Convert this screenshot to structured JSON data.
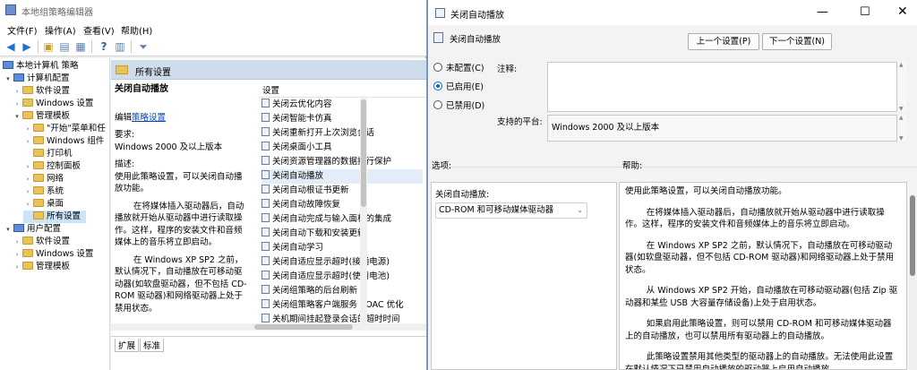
{
  "gpedit": {
    "title": "本地组策略编辑器",
    "menu": [
      "文件(F)",
      "操作(A)",
      "查看(V)",
      "帮助(H)"
    ],
    "tree": [
      {
        "label": "本地计算机 策略",
        "level": 0
      },
      {
        "label": "计算机配置",
        "level": 1
      },
      {
        "label": "软件设置",
        "level": 2
      },
      {
        "label": "Windows 设置",
        "level": 2
      },
      {
        "label": "管理模板",
        "level": 2
      },
      {
        "label": "\"开始\"菜单和任",
        "level": 3
      },
      {
        "label": "Windows 组件",
        "level": 3
      },
      {
        "label": "打印机",
        "level": 3
      },
      {
        "label": "控制面板",
        "level": 3
      },
      {
        "label": "网络",
        "level": 3
      },
      {
        "label": "系统",
        "level": 3
      },
      {
        "label": "桌面",
        "level": 3
      },
      {
        "label": "所有设置",
        "level": 3
      },
      {
        "label": "用户配置",
        "level": 1
      },
      {
        "label": "软件设置",
        "level": 2
      },
      {
        "label": "Windows 设置",
        "level": 2
      },
      {
        "label": "管理模板",
        "level": 2
      }
    ],
    "mid_header": "所有设置",
    "desc": {
      "title": "关闭自动播放",
      "edit_prefix": "编辑",
      "edit_link": "策略设置",
      "req_label": "要求:",
      "req_value": "Windows 2000 及以上版本",
      "desc_label": "描述:",
      "desc_p1": "使用此策略设置，可以关闭自动播放功能。",
      "desc_p2": "在将媒体插入驱动器后，自动播放就开始从驱动器中进行读取操作。这样，程序的安装文件和音频媒体上的音乐将立即启动。",
      "desc_p3": "在 Windows XP SP2 之前，默认情况下，自动播放在可移动驱动器(如软盘驱动器，但不包括 CD-ROM 驱动器)和网络驱动器上处于禁用状态。"
    },
    "list_header": "设置",
    "list_items": [
      "关闭云优化内容",
      "关闭智能卡仿真",
      "关闭重新打开上次浏览会话",
      "关闭桌面小工具",
      "关闭资源管理器的数据执行保护",
      "关闭自动播放",
      "关闭自动根证书更新",
      "关闭自动故障恢复",
      "关闭自动完成与输入面板的集成",
      "关闭自动下载和安装更新",
      "关闭自动学习",
      "关闭自适应显示超时(接通电源)",
      "关闭自适应显示超时(使用电池)",
      "关闭组策略的后台刷新",
      "关闭组策略客户端服务 AOAC 优化",
      "关机期间挂起登录会话的超时时间"
    ],
    "tabs": [
      "扩展",
      "标准"
    ]
  },
  "dialog": {
    "title": "关闭自动播放",
    "policy_name": "关闭自动播放",
    "prev_button": "上一个设置(P)",
    "next_button": "下一个设置(N)",
    "radios": [
      {
        "label": "未配置(C)",
        "checked": false
      },
      {
        "label": "已启用(E)",
        "checked": true
      },
      {
        "label": "已禁用(D)",
        "checked": false
      }
    ],
    "comment_label": "注释:",
    "platform_label": "支持的平台:",
    "platform_value": "Windows 2000 及以上版本",
    "options_label": "选项:",
    "help_label": "帮助:",
    "option_field_label": "关闭自动播放:",
    "option_value": "CD-ROM 和可移动媒体驱动器",
    "help_paragraphs": [
      "使用此策略设置，可以关闭自动播放功能。",
      "在将媒体插入驱动器后，自动播放就开始从驱动器中进行读取操作。这样，程序的安装文件和音频媒体上的音乐将立即启动。",
      "在 Windows XP SP2 之前，默认情况下，自动播放在可移动驱动器(如软盘驱动器，但不包括 CD-ROM 驱动器)和网络驱动器上处于禁用状态。",
      "从 Windows XP SP2 开始，自动播放在可移动驱动器(包括 Zip 驱动器和某些 USB 大容量存储设备)上处于启用状态。",
      "如果启用此策略设置，则可以禁用 CD-ROM 和可移动媒体驱动器上的自动播放，也可以禁用所有驱动器上的自动播放。",
      "此策略设置禁用其他类型的驱动器上的自动播放。无法使用此设置在默认情况下已禁用自动播放的驱动器上启用自动播放。"
    ]
  }
}
